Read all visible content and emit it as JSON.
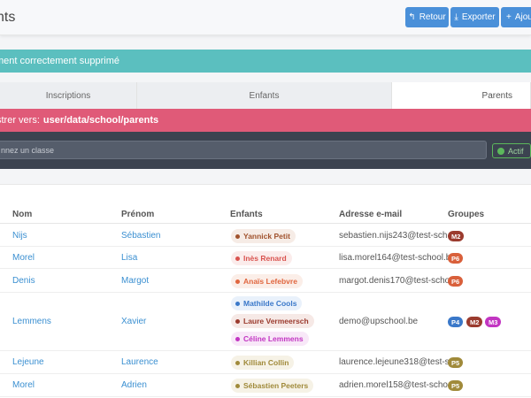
{
  "header": {
    "title": "nts",
    "buttons": [
      {
        "label": "Retour",
        "icon": "reply-icon",
        "glyph": "↰"
      },
      {
        "label": "Exporter",
        "icon": "download-icon",
        "glyph": "⤓"
      },
      {
        "label": "Ajou",
        "icon": "plus-icon",
        "glyph": "+"
      }
    ]
  },
  "alert": {
    "text": "ment correctement supprimé"
  },
  "tabs": [
    {
      "label": "Inscriptions",
      "active": false
    },
    {
      "label": "Enfants",
      "active": false
    },
    {
      "label": "Parents",
      "active": true
    }
  ],
  "register": {
    "prefix": "strer vers:",
    "path": "user/data/school/parents"
  },
  "filter": {
    "placeholder": "nnez un classe",
    "actif_label": "Actif"
  },
  "table": {
    "headers": [
      "Nom",
      "Prénom",
      "Enfants",
      "Adresse e-mail",
      "Groupes"
    ],
    "rows": [
      {
        "nom": "Nijs",
        "prenom": "Sébastien",
        "email": "sebastien.nijs243@test-sch…",
        "children": [
          {
            "name": "Yannick Petit",
            "color": "#a0522d",
            "bg": "#f6ece6"
          }
        ],
        "groups": [
          {
            "label": "M2",
            "color": "#9b3b2e"
          }
        ]
      },
      {
        "nom": "Morel",
        "prenom": "Lisa",
        "email": "lisa.morel164@test-school.be",
        "children": [
          {
            "name": "Inès Renard",
            "color": "#d9534f",
            "bg": "#fbeceb"
          }
        ],
        "groups": [
          {
            "label": "P6",
            "color": "#d9603b"
          }
        ]
      },
      {
        "nom": "Denis",
        "prenom": "Margot",
        "email": "margot.denis170@test-scho…",
        "children": [
          {
            "name": "Anaïs Lefebvre",
            "color": "#e0663f",
            "bg": "#fbeee8"
          }
        ],
        "groups": [
          {
            "label": "P6",
            "color": "#d9603b"
          }
        ]
      },
      {
        "nom": "Lemmens",
        "prenom": "Xavier",
        "email": "demo@upschool.be",
        "children": [
          {
            "name": "Mathilde Cools",
            "color": "#3a78c9",
            "bg": "#e9f1fb"
          },
          {
            "name": "Laure Vermeersch",
            "color": "#9b3b2e",
            "bg": "#f6e9e6"
          },
          {
            "name": "Céline Lemmens",
            "color": "#c235c2",
            "bg": "#f8e8f8"
          }
        ],
        "groups": [
          {
            "label": "P4",
            "color": "#3a78c9"
          },
          {
            "label": "M2",
            "color": "#9b3b2e"
          },
          {
            "label": "M3",
            "color": "#c235c2"
          }
        ]
      },
      {
        "nom": "Lejeune",
        "prenom": "Laurence",
        "email": "laurence.lejeune318@test-s…",
        "children": [
          {
            "name": "Killian Collin",
            "color": "#a08a3a",
            "bg": "#f6f2e6"
          }
        ],
        "groups": [
          {
            "label": "P5",
            "color": "#a08a3a"
          }
        ]
      },
      {
        "nom": "Morel",
        "prenom": "Adrien",
        "email": "adrien.morel158@test-scho…",
        "children": [
          {
            "name": "Sébastien Peeters",
            "color": "#a08a3a",
            "bg": "#f6f2e6"
          }
        ],
        "groups": [
          {
            "label": "P5",
            "color": "#a08a3a"
          }
        ]
      }
    ]
  }
}
